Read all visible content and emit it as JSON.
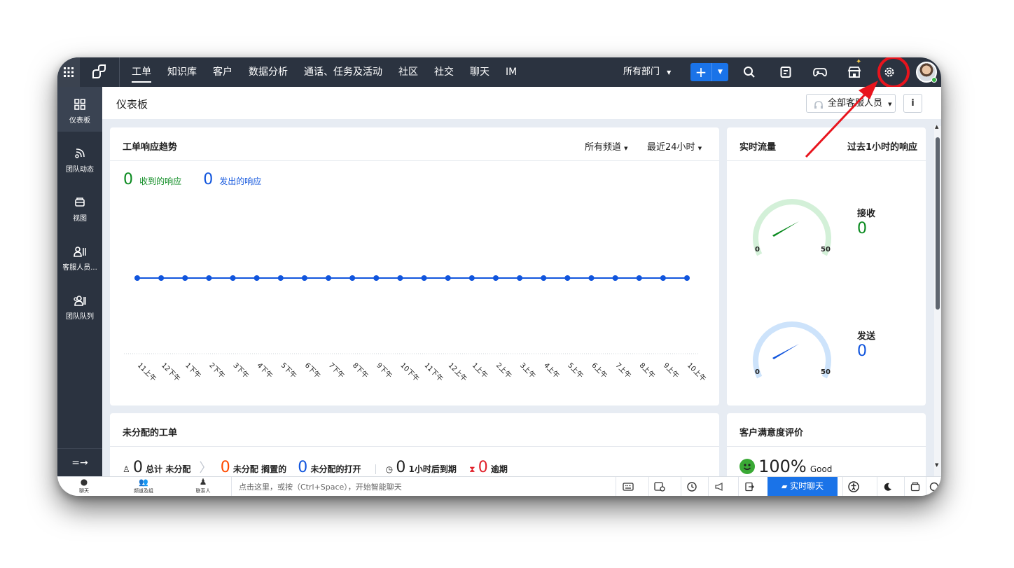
{
  "topbar": {
    "tabs": [
      "工单",
      "知识库",
      "客户",
      "数据分析",
      "通话、任务及活动",
      "社区",
      "社交",
      "聊天",
      "IM"
    ],
    "department": "所有部门",
    "add_label": "+"
  },
  "sidebar": {
    "items": [
      {
        "label": "仪表板",
        "icon": "dashboard-icon"
      },
      {
        "label": "团队动态",
        "icon": "feed-icon"
      },
      {
        "label": "视图",
        "icon": "views-icon"
      },
      {
        "label": "客服人员...",
        "icon": "agents-icon"
      },
      {
        "label": "团队队列",
        "icon": "team-queue-icon"
      }
    ],
    "collapse": "=→"
  },
  "header": {
    "title": "仪表板",
    "agent_filter": "全部客服人员",
    "info": "i"
  },
  "trend": {
    "title": "工单响应趋势",
    "channel": "所有频道",
    "range": "最近24小时",
    "received_count": "0",
    "received_label": "收到的响应",
    "sent_count": "0",
    "sent_label": "发出的响应"
  },
  "chart_data": {
    "type": "line",
    "categories": [
      "11上午",
      "12下午",
      "1下午",
      "2下午",
      "3下午",
      "4下午",
      "5下午",
      "6下午",
      "7下午",
      "8下午",
      "9下午",
      "10下午",
      "11下午",
      "12上午",
      "1上午",
      "2上午",
      "3上午",
      "4上午",
      "5上午",
      "6上午",
      "7上午",
      "8上午",
      "9上午",
      "10上午"
    ],
    "series": [
      {
        "values": [
          0,
          0,
          0,
          0,
          0,
          0,
          0,
          0,
          0,
          0,
          0,
          0,
          0,
          0,
          0,
          0,
          0,
          0,
          0,
          0,
          0,
          0,
          0,
          0
        ],
        "color": "#1155dd"
      }
    ]
  },
  "realtime": {
    "title": "实时流量",
    "subtitle": "过去1小时的响应",
    "gauges": [
      {
        "label": "接收",
        "value": "0",
        "min": "0",
        "max": "50",
        "color": "#0a8a1f",
        "track": "#d3f0d8"
      },
      {
        "label": "发送",
        "value": "0",
        "min": "0",
        "max": "50",
        "color": "#1155dd",
        "track": "#cde3fb"
      }
    ]
  },
  "unassigned": {
    "title": "未分配的工单",
    "total_count": "0",
    "total_label": "总计 未分配",
    "onhold_count": "0",
    "onhold_label": "未分配 搁置的",
    "open_count": "0",
    "open_label": "未分配的打开",
    "due_count": "0",
    "due_label": "1小时后到期",
    "overdue_count": "0",
    "overdue_label": "逾期"
  },
  "satisfaction": {
    "title": "客户满意度评价",
    "percent": "100%",
    "rating": "Good"
  },
  "bottombar": {
    "items": [
      "聊天",
      "频道及组",
      "联系人"
    ],
    "prompt": "点击这里，或按（Ctrl+Space），开始智能聊天",
    "live_chat": "实时聊天"
  },
  "colors": {
    "accent": "#1a73e8",
    "nav_bg": "#2b3340",
    "highlight": "#e8141d"
  }
}
